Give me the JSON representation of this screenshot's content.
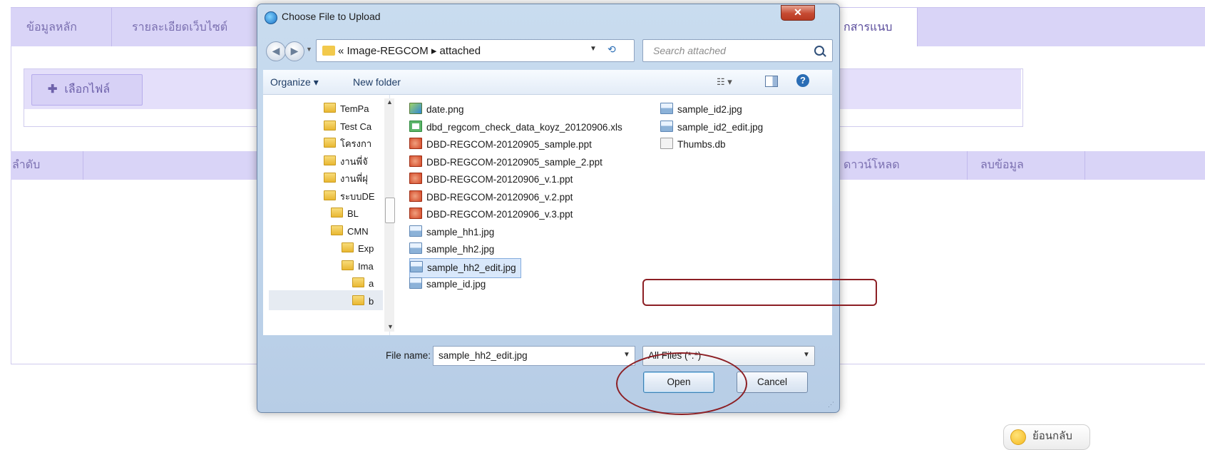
{
  "page": {
    "tabs": [
      {
        "label": "ข้อมูลหลัก"
      },
      {
        "label": "รายละเอียดเว็บไซต์"
      },
      {
        "label": "กสารแนบ"
      }
    ],
    "upload_button": "เลือกไฟล์",
    "table_headers": [
      "ลำดับ",
      "ดาวน์โหลด",
      "ลบข้อมูล"
    ],
    "back_button": "ย้อนกลับ"
  },
  "dialog": {
    "title": "Choose File to Upload",
    "address_path": "« Image-REGCOM ▸ attached",
    "search_placeholder": "Search attached",
    "toolbar": {
      "organize": "Organize ▾",
      "new_folder": "New folder"
    },
    "tree": [
      "TemPa",
      "Test Ca",
      "โครงกา",
      "งานพี่จั",
      "งานพี่ฝุ",
      "ระบบDE",
      "BL",
      "CMN",
      "Exp",
      "Ima",
      "a",
      "b"
    ],
    "files_col1": [
      {
        "name": "date.png",
        "type": "png"
      },
      {
        "name": "dbd_regcom_check_data_koyz_20120906.xls",
        "type": "xls"
      },
      {
        "name": "DBD-REGCOM-20120905_sample.ppt",
        "type": "ppt"
      },
      {
        "name": "DBD-REGCOM-20120905_sample_2.ppt",
        "type": "ppt"
      },
      {
        "name": "DBD-REGCOM-20120906_v.1.ppt",
        "type": "ppt"
      },
      {
        "name": "DBD-REGCOM-20120906_v.2.ppt",
        "type": "ppt"
      },
      {
        "name": "DBD-REGCOM-20120906_v.3.ppt",
        "type": "ppt"
      },
      {
        "name": "sample_hh1.jpg",
        "type": "img"
      },
      {
        "name": "sample_hh2.jpg",
        "type": "img"
      },
      {
        "name": "sample_hh2_edit.jpg",
        "type": "img",
        "selected": true
      },
      {
        "name": "sample_id.jpg",
        "type": "img"
      }
    ],
    "files_col2": [
      {
        "name": "sample_id2.jpg",
        "type": "img"
      },
      {
        "name": "sample_id2_edit.jpg",
        "type": "img"
      },
      {
        "name": "Thumbs.db",
        "type": "db"
      }
    ],
    "file_name_label": "File name:",
    "file_name_value": "sample_hh2_edit.jpg",
    "file_type_filter": "All Files (*.*)",
    "open_button": "Open",
    "cancel_button": "Cancel"
  },
  "colors": {
    "tab_bg": "#d9d4f7",
    "annotation": "#8c1f24",
    "dialog_chrome": "#c9dcef"
  }
}
